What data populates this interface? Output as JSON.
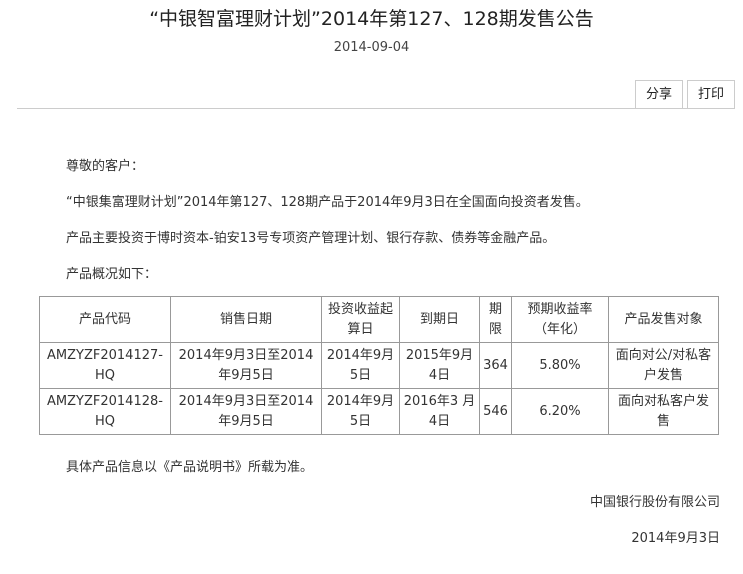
{
  "title": "“中银智富理财计划”2014年第127、128期发售公告",
  "date": "2014-09-04",
  "actions": {
    "share": "分享",
    "print": "打印"
  },
  "body": {
    "salutation": "尊敬的客户：",
    "announcement": "“中银集富理财计划”2014年第127、128期产品于2014年9月3日在全国面向投资者发售。",
    "investment": "产品主要投资于博时资本-铂安13号专项资产管理计划、银行存款、债券等金融产品。",
    "overview": "产品概况如下：",
    "footer_note": "具体产品信息以《产品说明书》所载为准。"
  },
  "table": {
    "headers": [
      "产品代码",
      "销售日期",
      "投资收益起算日",
      "到期日",
      "期限",
      "预期收益率（年化）",
      "产品发售对象"
    ],
    "rows": [
      [
        "AMZYZF2014127-HQ",
        "2014年9月3日至2014年9月5日",
        "2014年9月5日",
        "2015年9月4日",
        "364",
        "5.80%",
        "面向对公/对私客户发售"
      ],
      [
        "AMZYZF2014128-HQ",
        "2014年9月3日至2014年9月5日",
        "2014年9月5日",
        "2016年3 月4日",
        "546",
        "6.20%",
        "面向对私客户发售"
      ]
    ]
  },
  "signature": {
    "company": "中国银行股份有限公司",
    "date": "2014年9月3日"
  }
}
